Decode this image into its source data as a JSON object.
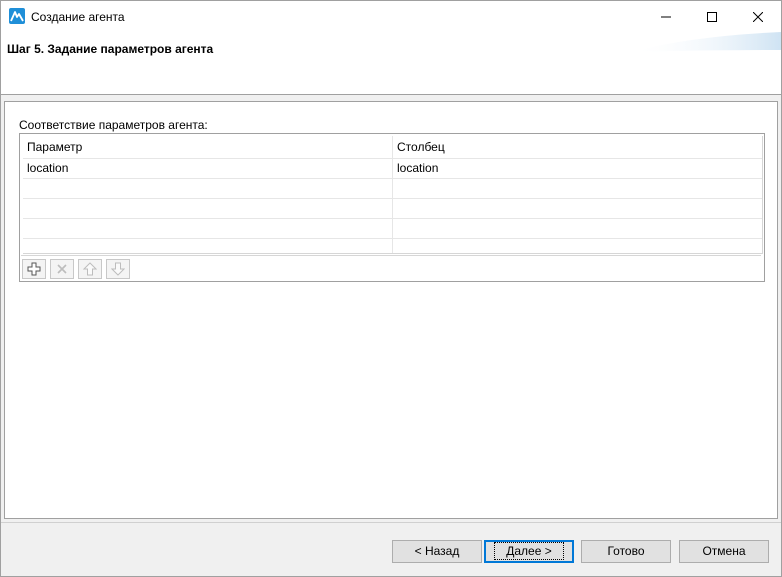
{
  "window": {
    "title": "Создание агента",
    "icons": {
      "app": "app-logo-icon",
      "minimize": "minimize-icon",
      "maximize": "maximize-icon",
      "close": "close-icon"
    }
  },
  "header": {
    "step_title": "Шаг 5. Задание параметров агента"
  },
  "mapping": {
    "label": "Соответствие параметров агента:",
    "columns": [
      "Параметр",
      "Столбец"
    ],
    "rows": [
      [
        "location",
        "location"
      ],
      [
        "",
        ""
      ],
      [
        "",
        ""
      ],
      [
        "",
        ""
      ],
      [
        "",
        ""
      ]
    ],
    "toolbar": [
      {
        "name": "add-row-button",
        "icon": "plus-icon",
        "enabled": true
      },
      {
        "name": "delete-row-button",
        "icon": "cross-icon",
        "enabled": false
      },
      {
        "name": "move-up-button",
        "icon": "arrow-up-icon",
        "enabled": false
      },
      {
        "name": "move-down-button",
        "icon": "arrow-down-icon",
        "enabled": false
      }
    ]
  },
  "buttons": {
    "back": "< Назад",
    "next": "Далее >",
    "finish": "Готово",
    "cancel": "Отмена"
  },
  "colors": {
    "accent": "#0078d7",
    "logo": "#1f8fd8"
  }
}
